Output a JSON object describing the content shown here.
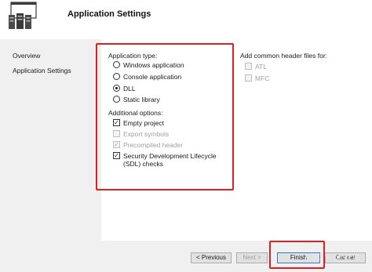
{
  "header": {
    "title": "Application Settings",
    "logo_icon": "wizard-server-icon"
  },
  "sidebar": {
    "items": [
      {
        "label": "Overview"
      },
      {
        "label": "Application Settings"
      }
    ]
  },
  "application_type": {
    "label": "Application type:",
    "options": [
      {
        "label": "Windows application",
        "selected": false
      },
      {
        "label": "Console application",
        "selected": false
      },
      {
        "label": "DLL",
        "selected": true
      },
      {
        "label": "Static library",
        "selected": false
      }
    ]
  },
  "additional_options": {
    "label": "Additional options:",
    "options": [
      {
        "label": "Empty project",
        "checked": true,
        "enabled": true
      },
      {
        "label": "Export symbols",
        "checked": false,
        "enabled": false
      },
      {
        "label": "Precompiled header",
        "checked": true,
        "enabled": false
      },
      {
        "label": "Security Development Lifecycle (SDL) checks",
        "checked": true,
        "enabled": true
      }
    ]
  },
  "common_headers": {
    "label": "Add common header files for:",
    "options": [
      {
        "label": "ATL",
        "checked": false,
        "enabled": false
      },
      {
        "label": "MFC",
        "checked": false,
        "enabled": false
      }
    ]
  },
  "buttons": {
    "previous": "< Previous",
    "next": "Next >",
    "finish": "Finish",
    "cancel": "Cancel"
  },
  "watermark": "CSDN @MFQ",
  "colors": {
    "highlight_border": "#e02020",
    "panel_background": "#ffffff",
    "dialog_background": "#f0f0f0"
  }
}
